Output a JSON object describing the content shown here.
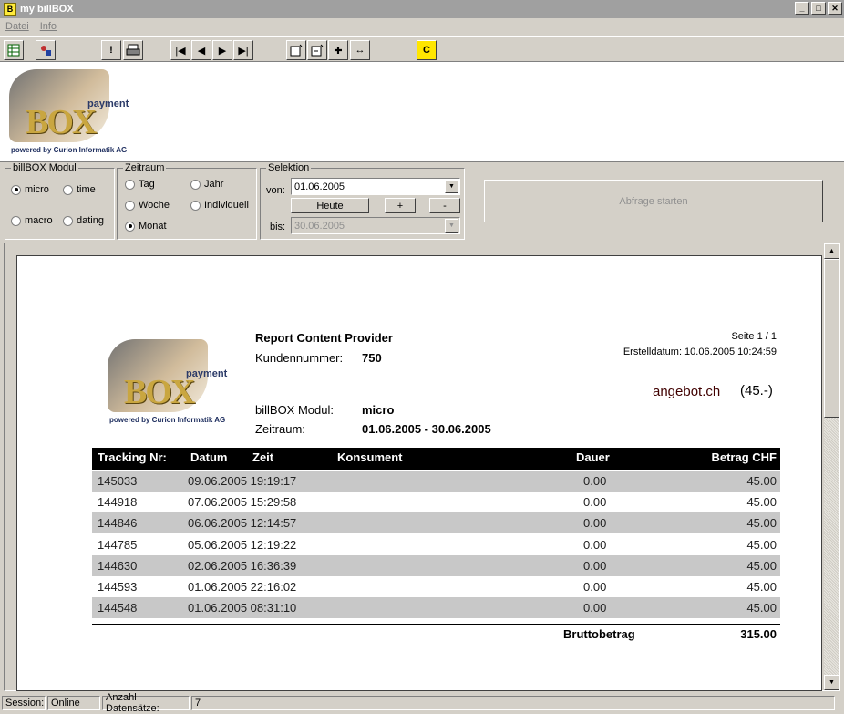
{
  "window": {
    "title": "my billBOX",
    "app_icon": "B",
    "min": "_",
    "max": "□",
    "close": "✕"
  },
  "menu": [
    "Datei",
    "Info"
  ],
  "logo": {
    "payment": "payment",
    "box": "BOX",
    "powered": "powered by Curion Informatik AG"
  },
  "modul": {
    "legend": "billBOX Modul",
    "options": [
      {
        "label": "micro",
        "checked": true
      },
      {
        "label": "time",
        "checked": false
      },
      {
        "label": "macro",
        "checked": false
      },
      {
        "label": "dating",
        "checked": false
      }
    ]
  },
  "zeitraum": {
    "legend": "Zeitraum",
    "options": [
      {
        "label": "Tag",
        "checked": false
      },
      {
        "label": "Jahr",
        "checked": false
      },
      {
        "label": "Woche",
        "checked": false
      },
      {
        "label": "Individuell",
        "checked": false
      },
      {
        "label": "Monat",
        "checked": true
      }
    ]
  },
  "selektion": {
    "legend": "Selektion",
    "von_label": "von:",
    "von_value": "01.06.2005",
    "heute": "Heute",
    "plus": "+",
    "minus": "-",
    "bis_label": "bis:",
    "bis_value": "30.06.2005"
  },
  "abfrage": "Abfrage starten",
  "report": {
    "title": "Report Content Provider",
    "kunden_label": "Kundennummer:",
    "kunden_value": "750",
    "seite": "Seite 1 / 1",
    "erstell": "Erstelldatum: 10.06.2005 10:24:59",
    "provider": "angebot.ch",
    "price": "(45.-)",
    "modul_label": "billBOX Modul:",
    "modul_value": "micro",
    "zeit_label": "Zeitraum:",
    "zeit_value": "01.06.2005 - 30.06.2005",
    "columns": [
      "Tracking Nr:",
      "Datum",
      "Zeit",
      "Konsument",
      "Dauer",
      "Betrag CHF"
    ],
    "rows": [
      [
        "145033",
        "09.06.2005 19:19:17",
        "0.00",
        "45.00"
      ],
      [
        "144918",
        "07.06.2005 15:29:58",
        "0.00",
        "45.00"
      ],
      [
        "144846",
        "06.06.2005 12:14:57",
        "0.00",
        "45.00"
      ],
      [
        "144785",
        "05.06.2005 12:19:22",
        "0.00",
        "45.00"
      ],
      [
        "144630",
        "02.06.2005 16:36:39",
        "0.00",
        "45.00"
      ],
      [
        "144593",
        "01.06.2005 22:16:02",
        "0.00",
        "45.00"
      ],
      [
        "144548",
        "01.06.2005 08:31:10",
        "0.00",
        "45.00"
      ]
    ],
    "total_label": "Bruttobetrag",
    "total_value": "315.00"
  },
  "status": {
    "session_label": "Session:",
    "session_value": "Online",
    "count_label": "Anzahl Datensätze:",
    "count_value": "7"
  }
}
